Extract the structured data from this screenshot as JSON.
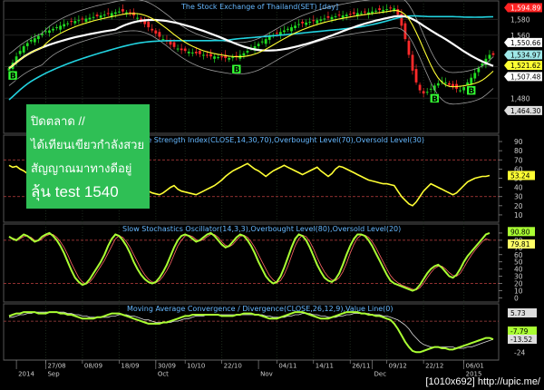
{
  "chart_data": [
    {
      "type": "candlestick",
      "title": "The Stock Exchange of Thailand(SET) [day]",
      "ylim": [
        1440,
        1600
      ],
      "y_ticks": [
        1480,
        1520,
        1560,
        1580
      ],
      "price_labels": [
        {
          "value": "1,594.89",
          "color": "#ff2222",
          "text_color": "#ffffff"
        },
        {
          "value": "1,580",
          "color": "#000000",
          "text_color": "#cccccc"
        },
        {
          "value": "1,560",
          "color": "#000000",
          "text_color": "#cccccc"
        },
        {
          "value": "1,550.66",
          "color": "#ffffff",
          "text_color": "#000000"
        },
        {
          "value": "1,534.97",
          "color": "#9fe8e8",
          "text_color": "#000000"
        },
        {
          "value": "1,521.62",
          "color": "#ffff33",
          "text_color": "#000000"
        },
        {
          "value": "1,507.48",
          "color": "#ffffff",
          "text_color": "#000000"
        },
        {
          "value": "1,480",
          "color": "#000000",
          "text_color": "#cccccc"
        },
        {
          "value": "1,464.30",
          "color": "#dddddd",
          "text_color": "#000000"
        }
      ],
      "buy_markers": [
        {
          "index": 1,
          "label": "B"
        },
        {
          "index": 62,
          "label": "B"
        },
        {
          "index": 116,
          "label": "B"
        },
        {
          "index": 126,
          "label": "B"
        }
      ],
      "closes": [
        1518,
        1525,
        1533,
        1540,
        1546,
        1550,
        1554,
        1556,
        1559,
        1562,
        1565,
        1566,
        1568,
        1570,
        1572,
        1574,
        1575,
        1577,
        1578,
        1579,
        1580,
        1581,
        1582,
        1583,
        1584,
        1585,
        1586,
        1587,
        1588,
        1589,
        1590,
        1590,
        1589,
        1587,
        1585,
        1582,
        1578,
        1574,
        1570,
        1566,
        1562,
        1558,
        1555,
        1552,
        1548,
        1545,
        1543,
        1541,
        1540,
        1539,
        1538,
        1537,
        1536,
        1535,
        1534,
        1533,
        1533,
        1532,
        1532,
        1531,
        1531,
        1532,
        1533,
        1535,
        1537,
        1540,
        1543,
        1546,
        1549,
        1552,
        1555,
        1558,
        1560,
        1562,
        1564,
        1566,
        1568,
        1570,
        1572,
        1574,
        1575,
        1576,
        1577,
        1578,
        1579,
        1580,
        1581,
        1582,
        1583,
        1584,
        1585,
        1585,
        1586,
        1586,
        1587,
        1588,
        1588,
        1589,
        1589,
        1590,
        1591,
        1592,
        1592,
        1593,
        1594,
        1594,
        1586,
        1572,
        1555,
        1535,
        1515,
        1500,
        1490,
        1486,
        1488,
        1492,
        1496,
        1499,
        1502,
        1500,
        1497,
        1495,
        1492,
        1490,
        1494,
        1500,
        1506,
        1512,
        1518,
        1524,
        1530,
        1535,
        1535
      ],
      "series": [
        {
          "name": "",
          "color": "#ffffff",
          "kind": "ma_long"
        },
        {
          "name": "",
          "color": "#22d3e0",
          "kind": "ma_slow"
        },
        {
          "name": "",
          "color": "#ffff33",
          "kind": "ma_short"
        },
        {
          "name": "",
          "color": "#888888",
          "kind": "band"
        }
      ]
    },
    {
      "type": "line",
      "title": "Relative Strength Index(CLOSE,14,30,70),Overbought Level(70),Oversold Level(30)",
      "ylim": [
        5,
        95
      ],
      "y_ticks": [
        10,
        20,
        30,
        40,
        50,
        60,
        70,
        80,
        90
      ],
      "levels": [
        70,
        30
      ],
      "values": [
        64,
        62,
        63,
        60,
        58,
        55,
        60,
        62,
        63,
        58,
        55,
        60,
        62,
        58,
        55,
        52,
        50,
        48,
        52,
        55,
        60,
        64,
        62,
        66,
        60,
        55,
        50,
        46,
        42,
        38,
        34,
        32,
        36,
        40,
        38,
        35,
        33,
        38,
        36,
        34,
        33,
        32,
        34,
        37,
        40,
        42,
        38,
        36,
        35,
        34,
        33,
        32,
        34,
        36,
        38,
        40,
        42,
        45,
        48,
        52,
        55,
        58,
        60,
        62,
        64,
        66,
        63,
        60,
        58,
        55,
        52,
        55,
        58,
        60,
        62,
        64,
        62,
        60,
        58,
        56,
        54,
        56,
        58,
        60,
        62,
        58,
        55,
        52,
        55,
        60,
        63,
        62,
        60,
        58,
        56,
        54,
        52,
        50,
        48,
        47,
        46,
        45,
        44,
        44,
        43,
        42,
        36,
        30,
        26,
        22,
        20,
        24,
        30,
        36,
        40,
        44,
        42,
        40,
        38,
        36,
        34,
        32,
        34,
        38,
        42,
        46,
        48,
        50,
        51,
        52,
        52,
        53
      ],
      "last_label": {
        "value": "53.24",
        "color": "#ffff33"
      },
      "color": "#ffff33"
    },
    {
      "type": "line",
      "title": "Slow Stochastics Oscillator(14,3,3),Overbought Level(80),Oversold Level(20)",
      "ylim": [
        -2,
        100
      ],
      "y_ticks": [
        0,
        10,
        20,
        30,
        40,
        50,
        60,
        70,
        80,
        90
      ],
      "levels": [
        80,
        20
      ],
      "series": [
        {
          "name": "",
          "color": "#aaff33",
          "values": [
            85,
            82,
            80,
            84,
            88,
            86,
            82,
            78,
            80,
            85,
            88,
            90,
            86,
            80,
            72,
            62,
            50,
            38,
            28,
            22,
            18,
            20,
            26,
            34,
            42,
            50,
            60,
            72,
            82,
            88,
            86,
            80,
            72,
            62,
            50,
            40,
            32,
            26,
            22,
            20,
            22,
            28,
            36,
            46,
            58,
            70,
            80,
            86,
            88,
            86,
            82,
            78,
            80,
            84,
            88,
            90,
            86,
            80,
            74,
            70,
            72,
            78,
            84,
            88,
            86,
            80,
            72,
            62,
            50,
            40,
            30,
            24,
            20,
            22,
            30,
            42,
            56,
            70,
            82,
            88,
            86,
            80,
            70,
            58,
            46,
            36,
            28,
            24,
            22,
            26,
            34,
            46,
            60,
            72,
            82,
            88,
            88,
            86,
            80,
            72,
            62,
            52,
            42,
            32,
            24,
            20,
            18,
            16,
            14,
            12,
            10,
            12,
            18,
            26,
            34,
            40,
            44,
            46,
            42,
            36,
            30,
            28,
            32,
            40,
            50,
            58,
            64,
            70,
            76,
            82,
            88,
            90
          ]
        },
        {
          "name": "",
          "color": "#ff6666",
          "values": [
            84,
            83,
            81,
            82,
            85,
            86,
            84,
            80,
            79,
            82,
            86,
            88,
            88,
            84,
            78,
            70,
            60,
            48,
            38,
            28,
            22,
            19,
            22,
            28,
            36,
            44,
            52,
            62,
            72,
            82,
            86,
            84,
            78,
            70,
            60,
            50,
            40,
            32,
            26,
            22,
            21,
            24,
            30,
            38,
            48,
            60,
            72,
            80,
            86,
            87,
            85,
            81,
            79,
            81,
            85,
            88,
            88,
            84,
            78,
            73,
            71,
            74,
            80,
            85,
            87,
            84,
            78,
            70,
            60,
            50,
            40,
            31,
            25,
            21,
            24,
            32,
            44,
            58,
            72,
            82,
            87,
            85,
            78,
            68,
            56,
            45,
            36,
            29,
            25,
            24,
            28,
            36,
            48,
            62,
            74,
            83,
            87,
            87,
            84,
            78,
            70,
            60,
            50,
            40,
            31,
            25,
            21,
            18,
            16,
            14,
            12,
            11,
            14,
            20,
            28,
            35,
            41,
            44,
            44,
            40,
            35,
            31,
            30,
            34,
            42,
            51,
            59,
            66,
            72,
            78,
            82,
            80
          ]
        }
      ],
      "last_labels": [
        {
          "value": "90.80",
          "color": "#aaff33"
        },
        {
          "value": "79.81",
          "color": "#ffff66"
        }
      ]
    },
    {
      "type": "line",
      "title": "Moving Average Convergence / Divergence(CLOSE,26,12,9),Value Line(0)",
      "ylim": [
        -28,
        12
      ],
      "y_ticks": [
        -24
      ],
      "levels": [
        0
      ],
      "series": [
        {
          "name": "",
          "color": "#aaff33",
          "values": [
            4,
            5,
            6,
            6,
            7,
            7,
            7,
            7,
            6,
            6,
            6,
            7,
            7,
            7,
            6,
            6,
            5,
            5,
            4,
            3,
            2,
            2,
            2,
            2,
            3,
            3,
            4,
            5,
            6,
            6,
            6,
            5,
            4,
            3,
            2,
            1,
            0,
            -1,
            -2,
            -2,
            -2,
            -2,
            -1,
            -1,
            0,
            1,
            2,
            3,
            4,
            4,
            5,
            5,
            5,
            5,
            5,
            5,
            5,
            5,
            4,
            4,
            4,
            4,
            5,
            5,
            6,
            6,
            6,
            5,
            5,
            4,
            3,
            2,
            2,
            2,
            3,
            4,
            5,
            6,
            7,
            7,
            7,
            6,
            5,
            4,
            3,
            2,
            2,
            2,
            3,
            4,
            5,
            6,
            7,
            7,
            7,
            7,
            6,
            6,
            5,
            5,
            4,
            4,
            3,
            2,
            1,
            -2,
            -6,
            -11,
            -16,
            -20,
            -23,
            -24,
            -24,
            -23,
            -22,
            -21,
            -20,
            -20,
            -21,
            -21,
            -22,
            -22,
            -21,
            -20,
            -19,
            -18,
            -17,
            -16,
            -15,
            -14,
            -13,
            -13,
            -14
          ]
        },
        {
          "name": "",
          "color": "#dddddd",
          "values": [
            3,
            3,
            4,
            5,
            5,
            6,
            6,
            7,
            7,
            7,
            7,
            7,
            7,
            7,
            7,
            7,
            6,
            6,
            5,
            5,
            4,
            4,
            3,
            3,
            3,
            3,
            3,
            3,
            4,
            4,
            5,
            5,
            5,
            4,
            4,
            3,
            2,
            1,
            1,
            0,
            -1,
            -1,
            -1,
            -1,
            -1,
            0,
            0,
            1,
            2,
            2,
            3,
            4,
            4,
            4,
            5,
            5,
            5,
            5,
            5,
            5,
            5,
            5,
            5,
            5,
            5,
            5,
            5,
            5,
            5,
            5,
            4,
            4,
            3,
            3,
            3,
            3,
            4,
            4,
            5,
            5,
            6,
            6,
            6,
            5,
            5,
            4,
            4,
            3,
            3,
            3,
            4,
            4,
            5,
            5,
            6,
            6,
            6,
            6,
            6,
            5,
            5,
            5,
            4,
            4,
            3,
            2,
            1,
            -1,
            -3,
            -6,
            -10,
            -13,
            -16,
            -18,
            -19,
            -20,
            -20,
            -20,
            -20,
            -20,
            -20,
            -20,
            -21,
            -21,
            -21,
            -20,
            -20,
            -19,
            -18,
            -17,
            -16,
            -15,
            -14
          ]
        }
      ],
      "last_labels": [
        {
          "value": "5.73",
          "color": "#dddddd"
        },
        {
          "value": "-7.79",
          "color": "#aaff33"
        },
        {
          "value": "-13.52",
          "color": "#dddddd"
        }
      ]
    }
  ],
  "x_axis": {
    "labels": [
      {
        "index": 2,
        "row": 1,
        "text": "2014"
      },
      {
        "index": 10,
        "row": 0,
        "text": "27/08"
      },
      {
        "index": 10,
        "row": 1,
        "text": "Sep"
      },
      {
        "index": 20,
        "row": 0,
        "text": "08/09"
      },
      {
        "index": 30,
        "row": 0,
        "text": "18/09"
      },
      {
        "index": 40,
        "row": 0,
        "text": "30/09"
      },
      {
        "index": 40,
        "row": 1,
        "text": "Oct"
      },
      {
        "index": 48,
        "row": 0,
        "text": "10/10"
      },
      {
        "index": 58,
        "row": 0,
        "text": "22/10"
      },
      {
        "index": 68,
        "row": 1,
        "text": "Nov"
      },
      {
        "index": 73,
        "row": 0,
        "text": "04/11"
      },
      {
        "index": 83,
        "row": 0,
        "text": "14/11"
      },
      {
        "index": 93,
        "row": 0,
        "text": "26/11"
      },
      {
        "index": 99,
        "row": 1,
        "text": "Dec"
      },
      {
        "index": 103,
        "row": 0,
        "text": "09/12"
      },
      {
        "index": 113,
        "row": 0,
        "text": "22/12"
      },
      {
        "index": 124,
        "row": 0,
        "text": "06/01"
      },
      {
        "index": 124,
        "row": 1,
        "text": "2015"
      }
    ]
  },
  "overlay": {
    "lines": [
      "ปิดตลาด //",
      "ได้เทียนเขียวกำลังสวย",
      "สัญญาณมาทางดีอยู่",
      "ลุ้น test 1540"
    ]
  },
  "watermark": "[1010x692] http://upic.me/"
}
